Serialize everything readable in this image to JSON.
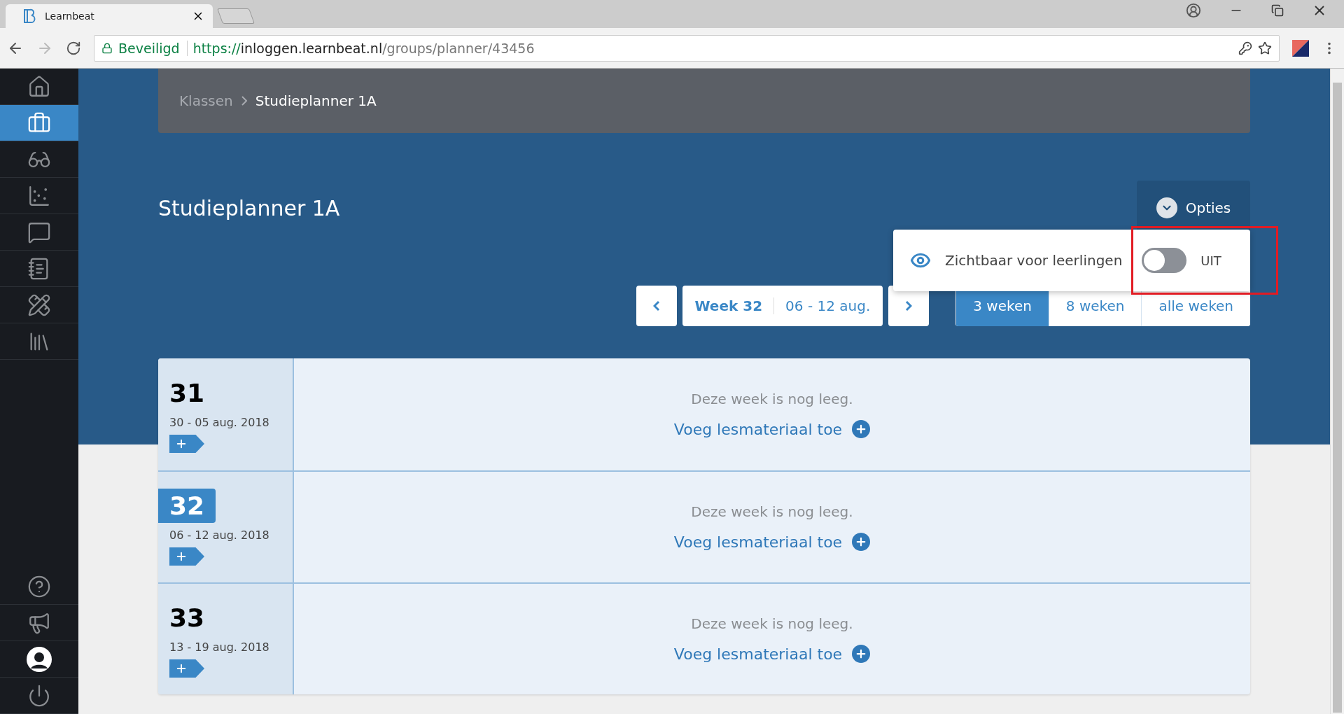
{
  "browser": {
    "tab_title": "Learnbeat",
    "secure_label": "Beveiligd",
    "url": {
      "scheme": "https://",
      "host": "inloggen.learnbeat.nl",
      "path": "/groups/planner/43456"
    }
  },
  "sidebar": {
    "items": [
      {
        "selected": false
      },
      {
        "selected": true
      },
      {
        "selected": false
      },
      {
        "selected": false
      },
      {
        "selected": false
      },
      {
        "selected": false
      },
      {
        "selected": false
      },
      {
        "selected": false
      }
    ],
    "bottom_items": [
      {
        "selected": false
      },
      {
        "selected": false
      },
      {
        "selected": false
      },
      {
        "selected": false
      }
    ]
  },
  "breadcrumb": [
    "Klassen",
    "Studieplanner 1A"
  ],
  "title": "Studieplanner 1A",
  "options_button": "Opties",
  "options_menu": {
    "label": "Zichtbaar voor leerlingen",
    "on": false,
    "state_text": "UIT",
    "highlighted": true
  },
  "week_nav": {
    "week": "Week 32",
    "range": "06 - 12 aug."
  },
  "range_tabs": [
    {
      "label": "3 weken",
      "selected": true
    },
    {
      "label": "8 weken",
      "selected": false
    },
    {
      "label": "alle weken",
      "selected": false
    }
  ],
  "weeks": [
    {
      "number": "31",
      "dates": "30 - 05 aug. 2018",
      "selected": false,
      "empty_text": "Deze week is nog leeg.",
      "add_link": "Voeg lesmateriaal toe"
    },
    {
      "number": "32",
      "dates": "06 - 12 aug. 2018",
      "selected": true,
      "empty_text": "Deze week is nog leeg.",
      "add_link": "Voeg lesmateriaal toe"
    },
    {
      "number": "33",
      "dates": "13 - 19 aug. 2018",
      "selected": false,
      "empty_text": "Deze week is nog leeg.",
      "add_link": "Voeg lesmateriaal toe"
    }
  ]
}
